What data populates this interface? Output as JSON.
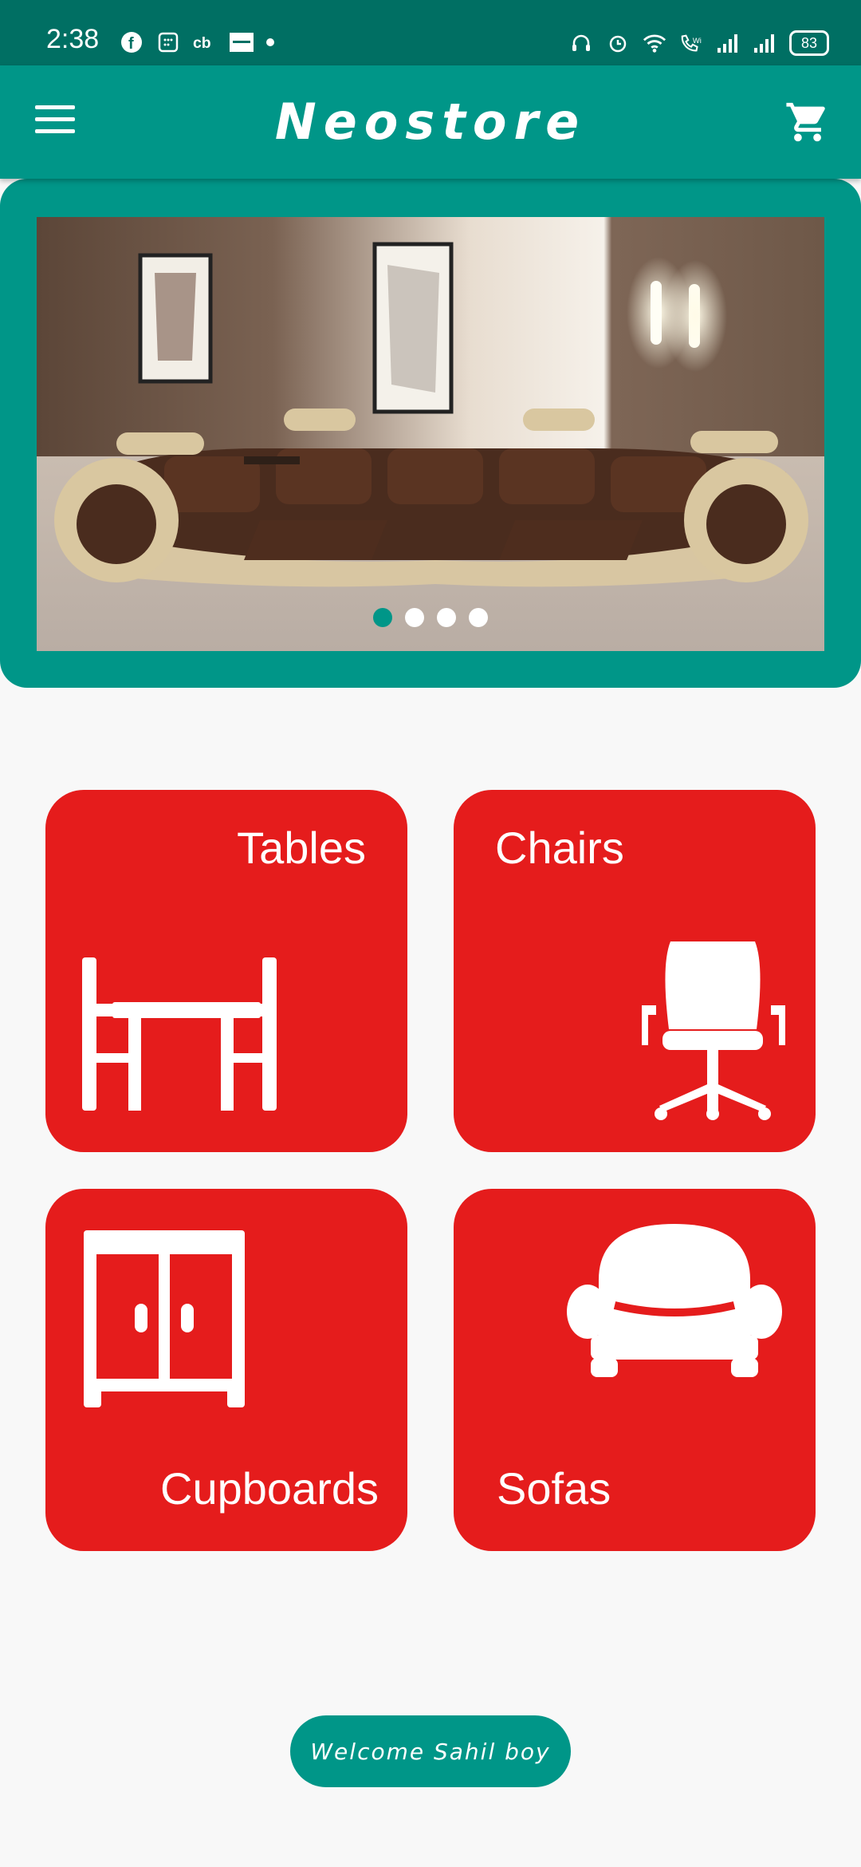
{
  "status": {
    "time": "2:38",
    "battery": "83",
    "left_icons": [
      "facebook-icon",
      "calendar-icon",
      "cb-icon",
      "zomato-icon",
      "notification-dot-icon"
    ],
    "right_icons": [
      "headset-icon",
      "alarm-icon",
      "wifi-icon",
      "wifi-calling-icon",
      "signal-icon",
      "signal-icon",
      "battery-icon"
    ]
  },
  "appbar": {
    "title": "Neostore",
    "menu_icon": "hamburger-menu-icon",
    "cart_icon": "cart-icon",
    "color": "#009688"
  },
  "banner": {
    "image": "living-room-sofa-photo",
    "slide_count": 4,
    "active_slide": 1
  },
  "categories": [
    {
      "label": "Tables",
      "icon": "table-icon"
    },
    {
      "label": "Chairs",
      "icon": "chair-icon"
    },
    {
      "label": "Cupboards",
      "icon": "cupboard-icon"
    },
    {
      "label": "Sofas",
      "icon": "sofa-icon"
    }
  ],
  "welcome": {
    "text": "Welcome Sahil boy"
  },
  "colors": {
    "primary": "#009688",
    "status_bar": "#006f63",
    "tile": "#e51c1c",
    "background": "#f8f8f8"
  }
}
